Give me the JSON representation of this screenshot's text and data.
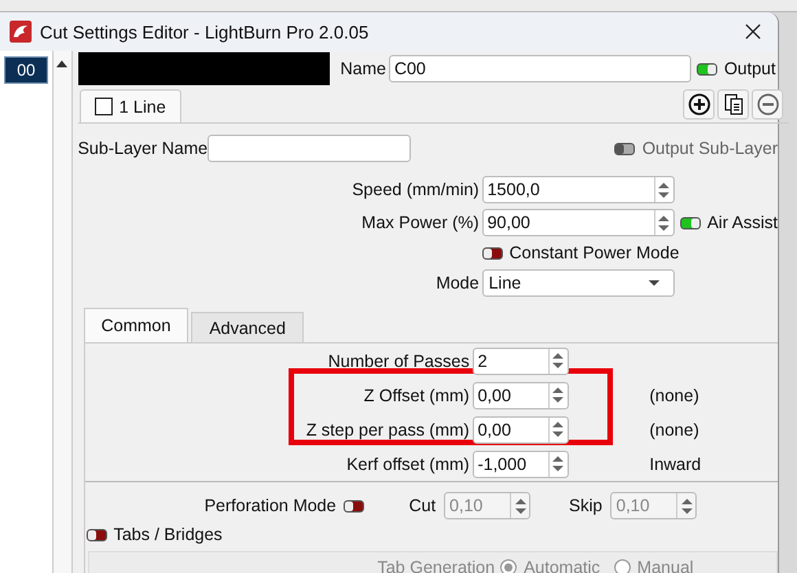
{
  "window": {
    "title": "Cut Settings Editor - LightBurn Pro 2.0.05"
  },
  "layers": [
    {
      "label": "00",
      "selected": true
    }
  ],
  "name": {
    "label": "Name",
    "value": "C00"
  },
  "output": {
    "label": "Output",
    "on": true
  },
  "sublayer_tabs": [
    {
      "label": "1 Line",
      "selected": true,
      "checked": false
    }
  ],
  "sublayer_name": {
    "label": "Sub-Layer Name"
  },
  "output_sublayer": {
    "label": "Output Sub-Layer",
    "on": false,
    "disabled": true
  },
  "speed": {
    "label": "Speed (mm/min)",
    "value": "1500,0"
  },
  "max_power": {
    "label": "Max Power (%)",
    "value": "90,00"
  },
  "air_assist": {
    "label": "Air Assist",
    "on": true
  },
  "constant_power_mode": {
    "label": "Constant Power Mode",
    "on": false
  },
  "mode": {
    "label": "Mode",
    "value": "Line"
  },
  "tabs": [
    {
      "label": "Common",
      "selected": true
    },
    {
      "label": "Advanced",
      "selected": false
    }
  ],
  "fields": [
    {
      "label": "Number of Passes",
      "value": "2"
    },
    {
      "label": "Z Offset (mm)",
      "value": "0,00",
      "note": "(none)"
    },
    {
      "label": "Z step per pass (mm)",
      "value": "0,00",
      "note": "(none)"
    },
    {
      "label": "Kerf offset (mm)",
      "value": "-1,000",
      "note": "Inward"
    }
  ],
  "perforation": {
    "label": "Perforation Mode",
    "on": false,
    "inputs": [
      {
        "label": "Cut",
        "value": "0,10",
        "disabled": true
      },
      {
        "label": "Skip",
        "value": "0,10",
        "disabled": true
      }
    ]
  },
  "tabs_bridges": {
    "label": "Tabs / Bridges",
    "on": false
  },
  "tab_generation": {
    "label": "Tab Generation",
    "disabled": true,
    "options": [
      {
        "label": "Automatic",
        "selected": true
      },
      {
        "label": "Manual",
        "selected": false
      }
    ]
  }
}
